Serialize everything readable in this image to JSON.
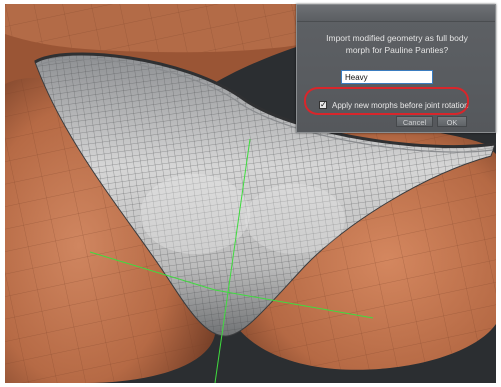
{
  "dialog": {
    "prompt_line1": "Import modified geometry as full body",
    "prompt_line2": "morph for Pauline Panties?",
    "morph_name_value": "Heavy",
    "apply_checkbox_checked": true,
    "apply_checkbox_mark": "✓",
    "apply_label": "Apply new morphs before joint rotation",
    "cancel_label": "Cancel",
    "ok_label": "OK"
  },
  "colors": {
    "annotation_circle": "#d8262b",
    "skin": "#c77a55",
    "garment": "#c9c9c9",
    "axis_green": "#3fdc3f"
  }
}
